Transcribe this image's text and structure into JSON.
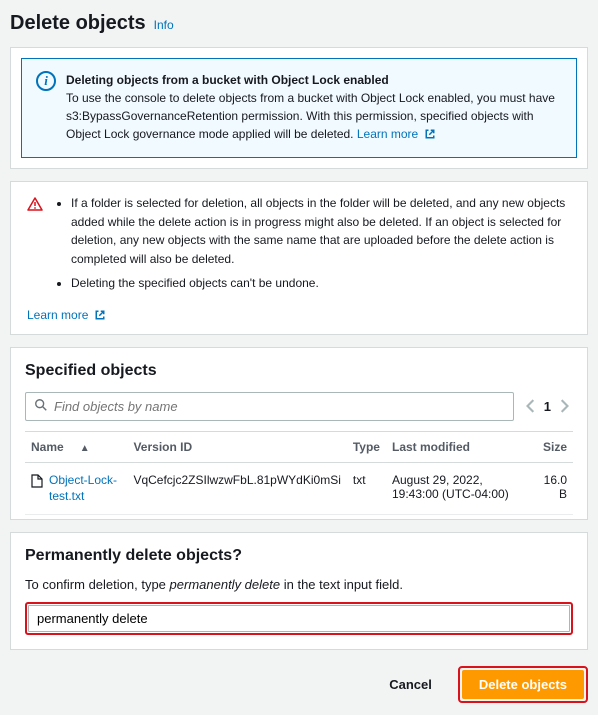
{
  "header": {
    "title": "Delete objects",
    "info": "Info"
  },
  "infoBox": {
    "title": "Deleting objects from a bucket with Object Lock enabled",
    "body": "To use the console to delete objects from a bucket with Object Lock enabled, you must have s3:BypassGovernanceRetention permission. With this permission, specified objects with Object Lock governance mode applied will be deleted.",
    "learnMore": "Learn more"
  },
  "warnings": {
    "items": [
      "If a folder is selected for deletion, all objects in the folder will be deleted, and any new objects added while the delete action is in progress might also be deleted. If an object is selected for deletion, any new objects with the same name that are uploaded before the delete action is completed will also be deleted.",
      "Deleting the specified objects can't be undone."
    ],
    "learnMore": "Learn more"
  },
  "specified": {
    "title": "Specified objects",
    "searchPlaceholder": "Find objects by name",
    "page": "1",
    "columns": {
      "name": "Name",
      "version": "Version ID",
      "type": "Type",
      "modified": "Last modified",
      "size": "Size"
    },
    "rows": [
      {
        "name": "Object-Lock-test.txt",
        "version": "VqCefcjc2ZSIlwzwFbL.81pWYdKi0mSi",
        "type": "txt",
        "modified": "August 29, 2022, 19:43:00 (UTC-04:00)",
        "size": "16.0 B"
      }
    ]
  },
  "confirm": {
    "title": "Permanently delete objects?",
    "prompt_pre": "To confirm deletion, type ",
    "prompt_em": "permanently delete",
    "prompt_post": " in the text input field.",
    "value": "permanently delete"
  },
  "footer": {
    "cancel": "Cancel",
    "delete": "Delete objects"
  }
}
